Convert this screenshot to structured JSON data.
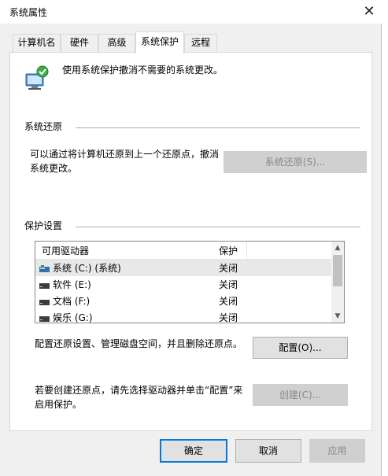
{
  "window": {
    "title": "系统属性",
    "close_icon": "close-icon"
  },
  "tabs": [
    {
      "label": "计算机名"
    },
    {
      "label": "硬件"
    },
    {
      "label": "高级"
    },
    {
      "label": "系统保护",
      "active": true
    },
    {
      "label": "远程"
    }
  ],
  "header": {
    "description": "使用系统保护撤消不需要的系统更改。"
  },
  "restore": {
    "group_title": "系统还原",
    "description_line1": "可以通过将计算机还原到上一个还原点，撤消",
    "description_line2": "系统更改。",
    "button": "系统还原(S)..."
  },
  "protection": {
    "group_title": "保护设置",
    "columns": [
      "可用驱动器",
      "保护"
    ],
    "rows": [
      {
        "drive": "系统 (C:) (系统)",
        "status": "关闭",
        "selected": true
      },
      {
        "drive": "软件 (E:)",
        "status": "关闭"
      },
      {
        "drive": "文档 (F:)",
        "status": "关闭"
      },
      {
        "drive": "娱乐 (G:)",
        "status": "关闭"
      }
    ],
    "configure_text": "配置还原设置、管理磁盘空间，并且删除还原点。",
    "configure_button": "配置(O)...",
    "create_text_line1": "若要创建还原点，请先选择驱动器并单击“配置”来",
    "create_text_line2": "启用保护。",
    "create_button": "创建(C)..."
  },
  "footer": {
    "ok": "确定",
    "cancel": "取消",
    "apply": "应用"
  },
  "colors": {
    "accent": "#0078d7",
    "window_bg": "#f0f0f0",
    "panel_bg": "#ffffff"
  }
}
